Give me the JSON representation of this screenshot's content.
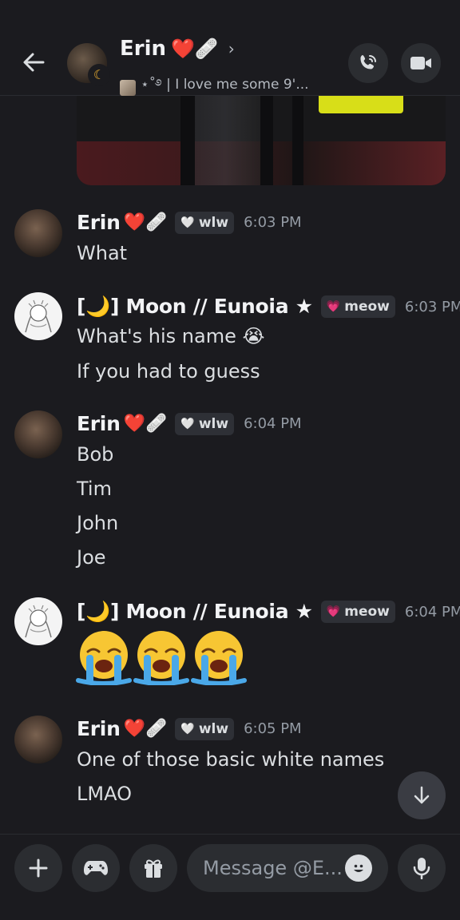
{
  "header": {
    "name": "Erin",
    "name_emoji": "❤️🩹",
    "status_text": "⋆˚࿔ | I love me some 9'...",
    "chevron": "›"
  },
  "messages": [
    {
      "author": "Erin",
      "author_emoji": "❤️🩹",
      "tag": "wlw",
      "tag_heart": "🤍",
      "time": "6:03 PM",
      "lines": [
        "What"
      ]
    },
    {
      "author": "[🌙] Moon // Eunoia ★",
      "tag": "meow",
      "tag_heart": "💗",
      "time": "6:03 PM",
      "lines": [
        "What's his name 😭",
        "If you had to guess"
      ]
    },
    {
      "author": "Erin",
      "author_emoji": "❤️🩹",
      "tag": "wlw",
      "tag_heart": "🤍",
      "time": "6:04 PM",
      "lines": [
        "Bob",
        "Tim",
        "John",
        "Joe"
      ]
    },
    {
      "author": "[🌙] Moon // Eunoia ★",
      "tag": "meow",
      "tag_heart": "💗",
      "time": "6:04 PM",
      "lines": []
    },
    {
      "author": "Erin",
      "author_emoji": "❤️🩹",
      "tag": "wlw",
      "tag_heart": "🤍",
      "time": "6:05 PM",
      "lines": [
        "One of those basic white names",
        "LMAO"
      ]
    }
  ],
  "emoji_message": {
    "emojis": [
      "loudly-crying-face",
      "loudly-crying-face",
      "loudly-crying-face"
    ]
  },
  "composer": {
    "placeholder": "Message @E..."
  },
  "colors": {
    "background": "#1b1b1f",
    "button_bg": "#2b2d31",
    "text": "#dbdee1",
    "muted": "#949ba4"
  }
}
